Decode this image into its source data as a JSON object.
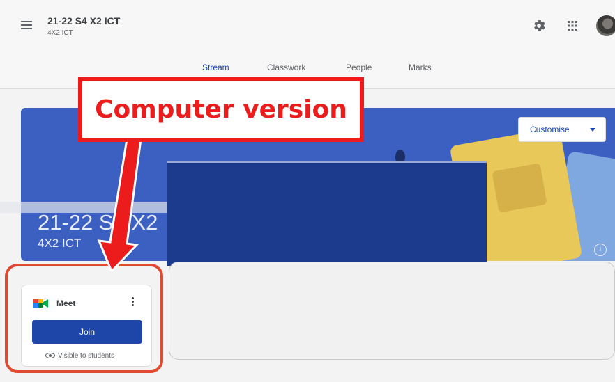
{
  "header": {
    "class_title": "21-22 S4 X2 ICT",
    "class_subtitle": "4X2 ICT",
    "icons": [
      "menu-icon",
      "gear-icon",
      "apps-icon",
      "avatar"
    ]
  },
  "tabs": [
    {
      "label": "Stream",
      "active": true
    },
    {
      "label": "Classwork",
      "active": false
    },
    {
      "label": "People",
      "active": false
    },
    {
      "label": "Marks",
      "active": false
    }
  ],
  "banner": {
    "title": "21-22 S4 X2",
    "subtitle": "4X2 ICT",
    "customise_label": "Customise",
    "info_icon": "info-icon",
    "color": "#3c60c2"
  },
  "meet": {
    "label": "Meet",
    "join_label": "Join",
    "visibility_text": "Visible to students",
    "accent_color": "#1d46a8"
  },
  "annotation": {
    "callout_text": "Computer version",
    "color": "#ed1c1c"
  }
}
